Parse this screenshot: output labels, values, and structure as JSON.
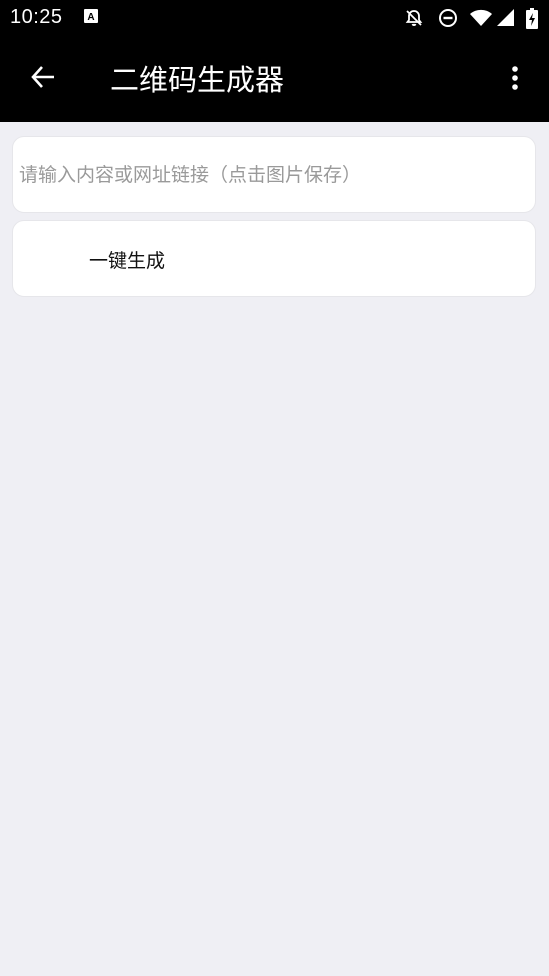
{
  "status_bar": {
    "time": "10:25",
    "icons": [
      "keyboard-a-icon",
      "bell-off-icon",
      "do-not-disturb-icon",
      "wifi-icon",
      "cell-signal-icon",
      "battery-charging-icon"
    ]
  },
  "app_bar": {
    "back_icon": "arrow-left-icon",
    "title": "二维码生成器",
    "overflow_icon": "more-vertical-icon"
  },
  "form": {
    "input_value": "",
    "input_placeholder": "请输入内容或网址链接（点击图片保存）",
    "generate_label": "一键生成"
  },
  "colors": {
    "bar_background": "#000000",
    "page_background": "#efeff4",
    "card_background": "#ffffff",
    "placeholder_text": "#9a9a9a"
  }
}
